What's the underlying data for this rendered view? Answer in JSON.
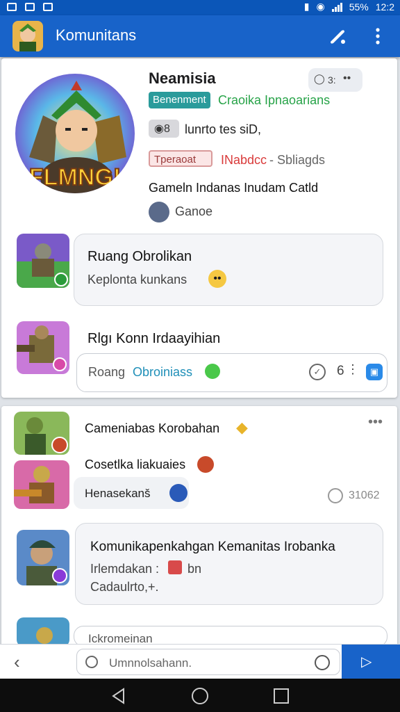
{
  "status_bar": {
    "battery": "55%",
    "time": "12:2"
  },
  "app_bar": {
    "title": "Komunitans"
  },
  "profile": {
    "name": "Neamisia",
    "stat_value": "3:",
    "badge_1": "Benenment",
    "badge_1_subtitle": "Craoika Ipnaoarians",
    "info_1": "lunrto tes siD,",
    "badge_2": "Tperaoat",
    "badge_2_status": "INabdcc",
    "badge_2_suffix": "- Sbliagds",
    "description": "Gameln Indanas Inudam Catld",
    "game_label": "Ganoe",
    "art_text": "FLMNG!"
  },
  "chat1": {
    "title": "Ruang Obrolikan",
    "subtitle": "Keplonta kunkans",
    "header2": "Rlgı Konn Irdaayihian",
    "input_label": "Roang",
    "input_highlight": "Obroiniass",
    "count": "6"
  },
  "feed": {
    "post_title": "Cameniabas Korobahan",
    "post_sub": "Cosetlka liakuaies",
    "chip_text": "Henasekanš",
    "timestamp": "31062",
    "bubble_title": "Komunikapenkahgan Kemanitas Irobanka",
    "bubble_line1": "Irlemdakan :",
    "bubble_line1b": "bn",
    "bubble_line2": "Cadaulrto,+.",
    "last_input": "Ickromeinan"
  },
  "composer": {
    "placeholder": "Umnnolsahann."
  },
  "colors": {
    "primary": "#1863c9",
    "accent_green": "#27a348",
    "accent_red": "#d93a3a",
    "teal": "#2a9b9b"
  }
}
